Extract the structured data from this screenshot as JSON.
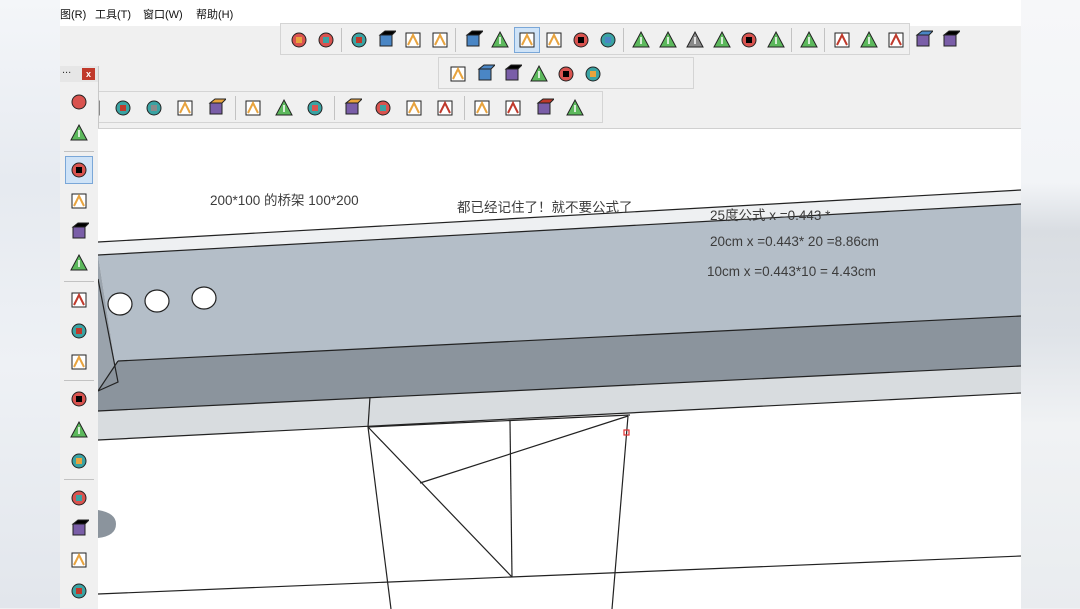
{
  "menu": {
    "items": [
      "图(R)",
      "工具(T)",
      "窗口(W)",
      "帮助(H)"
    ]
  },
  "toolbar": {
    "row1_icons": [
      "iso-view-icon",
      "top-view-icon",
      "front-view-icon",
      "right-view-icon",
      "back-view-icon",
      "left-view-icon",
      "xray-style-icon",
      "wireframe-style-icon",
      "hidden-line-style-icon",
      "shaded-style-icon",
      "textured-style-icon",
      "monochrome-style-icon",
      "house-front-icon",
      "house-side-icon",
      "house-top-icon",
      "house-back-icon",
      "house-outline-icon",
      "house-garage-icon",
      "section-plane-icon",
      "union-icon",
      "subtract-icon",
      "intersect-icon",
      "trim-icon",
      "split-icon"
    ],
    "row2_icons": [
      "tape-measure-icon",
      "dimension-icon",
      "protractor-icon",
      "text-label-icon",
      "axes-icon",
      "3d-text-icon"
    ],
    "row3_icons": [
      "pushpull-icon",
      "followme-icon",
      "move-icon",
      "rotate-icon",
      "scale-icon",
      "tape-measure-icon",
      "text-label-icon",
      "paint-bucket-icon",
      "orbit-icon",
      "pan-icon",
      "zoom-icon",
      "zoom-extents-icon",
      "warehouse-icon",
      "extension-icon",
      "layout-icon",
      "export-icon"
    ]
  },
  "side_toolbar": {
    "title_dots": "...",
    "close_label": "x",
    "icons": [
      "component-icon",
      "eraser-icon",
      "pencil-icon",
      "freehand-icon",
      "arc-icon",
      "pie-icon",
      "pushpull-icon",
      "followme-icon",
      "offset-icon",
      "axes-icon",
      "text-label-icon",
      "3d-text-icon",
      "pan-icon",
      "zoom-window-icon",
      "zoom-icon",
      "walk-icon"
    ]
  },
  "annotations": {
    "bridge_size": "200*100  的桥架    100*200",
    "memo": "都已经记住了！就不要公式了",
    "formula": "25度公式  x  =0.443  *",
    "calc_20cm": "20cm  x =0.443* 20 =8.86cm",
    "calc_10cm": "10cm  x =0.443*10   = 4.43cm"
  },
  "colors": {
    "tray_top": "#b4bec8",
    "tray_lower": "#8b949d",
    "tray_edge": "#d8dcdf",
    "selection": "#cfe3f7",
    "line": "#222222"
  }
}
